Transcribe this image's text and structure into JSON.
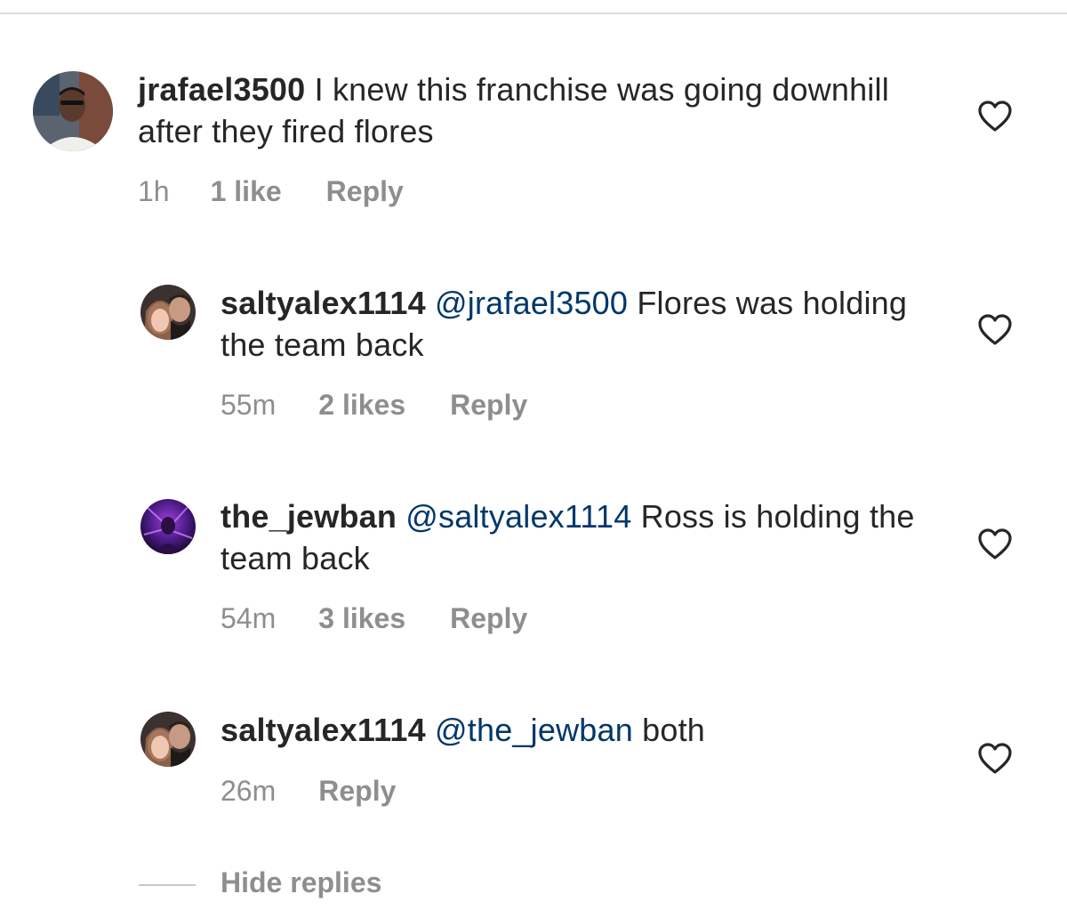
{
  "comments": [
    {
      "username": "jrafael3500",
      "mention": "",
      "text": "I knew this franchise was going downhill after they fired flores",
      "time": "1h",
      "likes": "1 like",
      "reply": "Reply",
      "like_icon": "heart-outline-icon"
    },
    {
      "username": "saltyalex1114",
      "mention": "@jrafael3500",
      "text": "Flores was holding the team back",
      "time": "55m",
      "likes": "2 likes",
      "reply": "Reply",
      "like_icon": "heart-outline-icon"
    },
    {
      "username": "the_jewban",
      "mention": "@saltyalex1114",
      "text": "Ross is holding the team back",
      "time": "54m",
      "likes": "3 likes",
      "reply": "Reply",
      "like_icon": "heart-outline-icon"
    },
    {
      "username": "saltyalex1114",
      "mention": "@the_jewban",
      "text": "both",
      "time": "26m",
      "likes": "",
      "reply": "Reply",
      "like_icon": "heart-outline-icon"
    }
  ],
  "hide_replies_label": "Hide replies",
  "colors": {
    "text": "#262626",
    "mention": "#00376b",
    "secondary": "#8e8e8e",
    "divider": "#dbdbdb"
  }
}
